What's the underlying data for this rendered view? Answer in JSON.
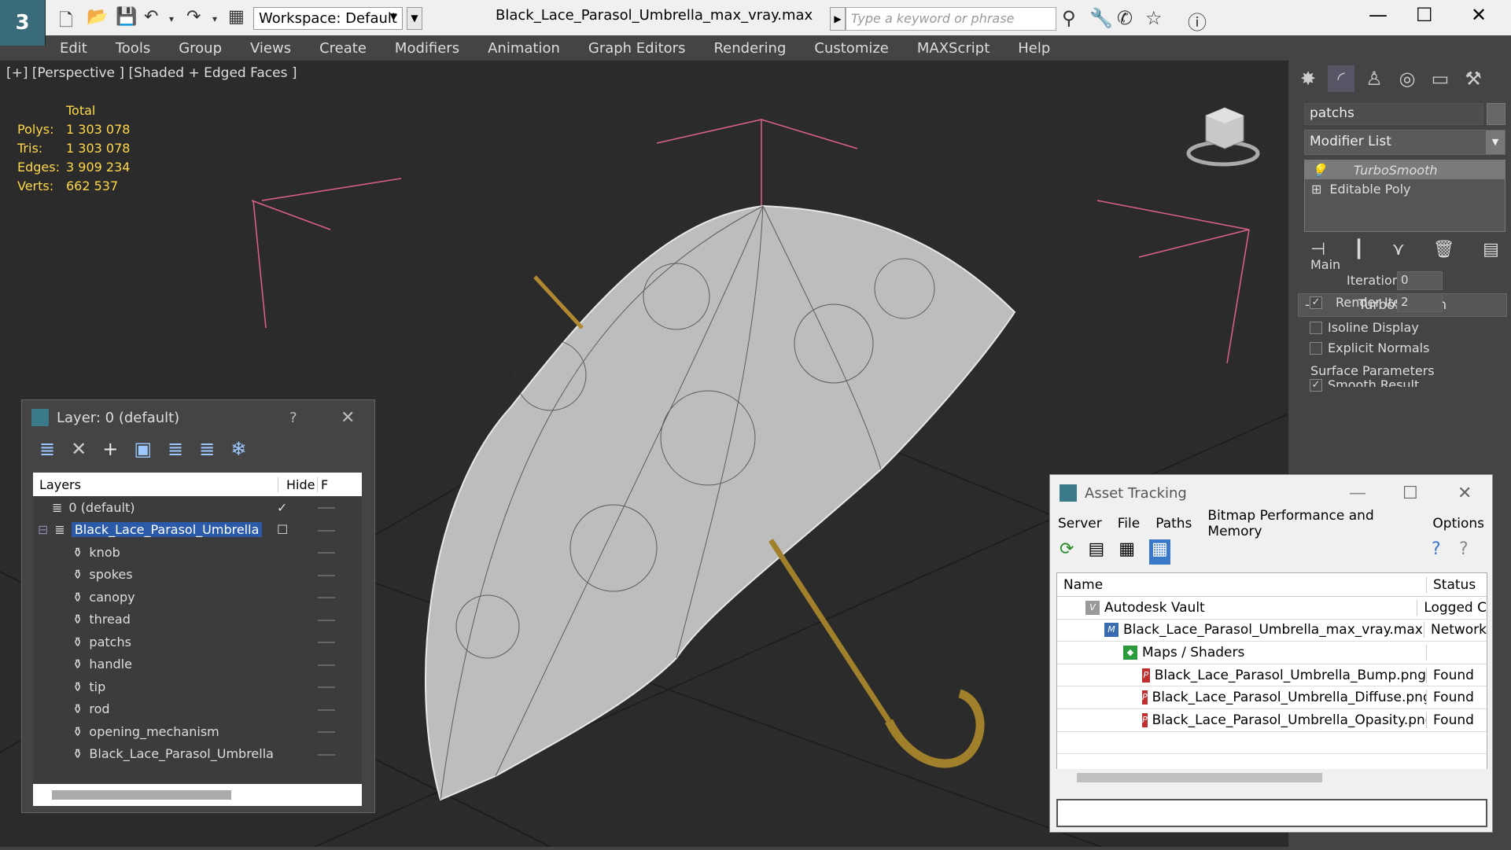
{
  "app": {
    "logo": "3",
    "title": "Black_Lace_Parasol_Umbrella_max_vray.max",
    "workspace": "Workspace: Default",
    "search_placeholder": "Type a keyword or phrase"
  },
  "menu": [
    "Edit",
    "Tools",
    "Group",
    "Views",
    "Create",
    "Modifiers",
    "Animation",
    "Graph Editors",
    "Rendering",
    "Customize",
    "MAXScript",
    "Help"
  ],
  "viewport": {
    "label": "[+] [Perspective ] [Shaded + Edged Faces ]",
    "stats": {
      "header": "Total",
      "rows": [
        {
          "k": "Polys:",
          "v": "1 303 078"
        },
        {
          "k": "Tris:",
          "v": "1 303 078"
        },
        {
          "k": "Edges:",
          "v": "3 909 234"
        },
        {
          "k": "Verts:",
          "v": "662 537"
        }
      ]
    }
  },
  "right_panel": {
    "object_name": "patchs",
    "modifier_list": "Modifier List",
    "stack": [
      "TurboSmooth",
      "Editable Poly"
    ],
    "rollout": "TurboSmooth",
    "main_group": "Main",
    "iterations_label": "Iterations:",
    "iterations": "0",
    "render_iters_label": "Render Iters:",
    "render_iters": "2",
    "isoline": "Isoline Display",
    "explicit": "Explicit Normals",
    "surface_group": "Surface Parameters",
    "smooth_result": "Smooth Result"
  },
  "layer_win": {
    "title": "Layer: 0 (default)",
    "help": "?",
    "col_layers": "Layers",
    "col_hide": "Hide",
    "col_f": "F",
    "rows": [
      {
        "name": "0 (default)",
        "indent": 0
      },
      {
        "name": "Black_Lace_Parasol_Umbrella",
        "indent": 1
      },
      {
        "name": "knob",
        "indent": 2
      },
      {
        "name": "spokes",
        "indent": 2
      },
      {
        "name": "canopy",
        "indent": 2
      },
      {
        "name": "thread",
        "indent": 2
      },
      {
        "name": "patchs",
        "indent": 2
      },
      {
        "name": "handle",
        "indent": 2
      },
      {
        "name": "tip",
        "indent": 2
      },
      {
        "name": "rod",
        "indent": 2
      },
      {
        "name": "opening_mechanism",
        "indent": 2
      },
      {
        "name": "Black_Lace_Parasol_Umbrella",
        "indent": 2
      }
    ]
  },
  "asset_win": {
    "title": "Asset Tracking",
    "menu": [
      "Server",
      "File",
      "Paths",
      "Bitmap Performance and Memory",
      "Options"
    ],
    "col_name": "Name",
    "col_status": "Status",
    "rows": [
      {
        "name": "Autodesk Vault",
        "status": "Logged C",
        "indent": 1,
        "icon": "vault"
      },
      {
        "name": "Black_Lace_Parasol_Umbrella_max_vray.max",
        "status": "Network",
        "indent": 2,
        "icon": "max"
      },
      {
        "name": "Maps / Shaders",
        "status": "",
        "indent": 3,
        "icon": "maps"
      },
      {
        "name": "Black_Lace_Parasol_Umbrella_Bump.png",
        "status": "Found",
        "indent": 4,
        "icon": "png"
      },
      {
        "name": "Black_Lace_Parasol_Umbrella_Diffuse.png",
        "status": "Found",
        "indent": 4,
        "icon": "png"
      },
      {
        "name": "Black_Lace_Parasol_Umbrella_Opasity.png",
        "status": "Found",
        "indent": 4,
        "icon": "png"
      }
    ]
  }
}
